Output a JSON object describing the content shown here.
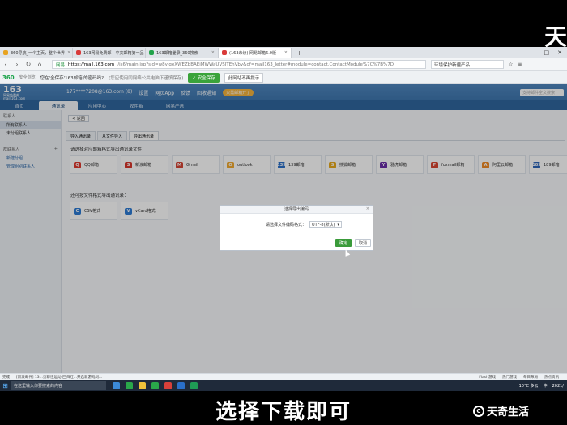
{
  "watermark": {
    "top": "天",
    "bottom": "天奇生活",
    "logo_glyph": "C"
  },
  "subtitle": "选择下载即可",
  "browser": {
    "tabs": [
      {
        "label": "360导航_一个主页，整个世界",
        "color": "#e8a320",
        "active": false
      },
      {
        "label": "163网易免费邮 - 中文邮箱第一品",
        "color": "#d93a3a",
        "active": false
      },
      {
        "label": "163邮箱登录_360搜索",
        "color": "#22a34a",
        "active": false
      },
      {
        "label": "(163未读) 网易邮箱6.0版",
        "color": "#d93a3a",
        "active": true
      }
    ],
    "tab_add": "+",
    "url": {
      "secure_label": "网易",
      "host": "https://mail.163.com",
      "path": "/js6/main.jsp?sid=w8yiqeXWEZbBAEjMWWaUVSITEhVby&df=mail163_letter#module=contact.ContactModule%7C%7B%7D"
    },
    "search_placeholder": "环境保护新疆产品",
    "addr_right": [
      "☆",
      "≡"
    ]
  },
  "secbar": {
    "logo": "360",
    "logo_sub": "安全浏览",
    "question": "您在'全保存'163邮箱'的密码吗?",
    "note": "(您应使用同网络公共电脑下谨慎保存)",
    "save_button": "✓ 安全保存",
    "dont_save_button": "此网站不再提示"
  },
  "mail": {
    "logo": "163",
    "logo_brand": "网易免费邮",
    "logo_domain": "mail.163.com",
    "account": "177****7208@163.com (8)",
    "links": [
      "设置",
      "网页App",
      "反馈",
      "回收通知"
    ],
    "promo": "只需邮箱开了",
    "search_placeholder": "支持邮件全文搜索",
    "nav": [
      "首页",
      "通讯录",
      "应用中心",
      "收件箱",
      "网易严选"
    ],
    "nav_active": 1,
    "sidebar": {
      "section1": "联系人",
      "items1": [
        "所有联系人",
        "未分组联系人"
      ],
      "section2": "群联系人",
      "section2_add": "+",
      "items2": [
        "新建分组",
        "管理组别联系人"
      ]
    },
    "back": "< 返回",
    "subtabs": [
      "导入通讯录",
      "从文件导入",
      "导出通讯录"
    ],
    "subtab_active": 2,
    "hint": "请选择对应邮箱格式导出通讯录文件：",
    "providers": [
      {
        "label": "QQ邮箱",
        "color": "#e0382c",
        "glyph": "Q"
      },
      {
        "label": "新浪邮箱",
        "color": "#d9362b",
        "glyph": "S"
      },
      {
        "label": "Gmail",
        "color": "#d64534",
        "glyph": "M"
      },
      {
        "label": "outlook",
        "color": "#f0a82f",
        "glyph": "O"
      },
      {
        "label": "139邮箱",
        "color": "#2a6fc9",
        "glyph": "139"
      },
      {
        "label": "搜狐邮箱",
        "color": "#e7a91d",
        "glyph": "S"
      },
      {
        "label": "雅虎邮箱",
        "color": "#6a2ea8",
        "glyph": "Y"
      },
      {
        "label": "foxmail邮箱",
        "color": "#d84430",
        "glyph": "F"
      },
      {
        "label": "阿里云邮箱",
        "color": "#f08a24",
        "glyph": "A"
      },
      {
        "label": "189邮箱",
        "color": "#2c64b8",
        "glyph": "189"
      }
    ],
    "hint2": "还可按文件格式导出通讯录：",
    "formats": [
      {
        "label": "CSV格式",
        "color": "#2c7bd4",
        "glyph": "C"
      },
      {
        "label": "vCard格式",
        "color": "#2c7bd4",
        "glyph": "V"
      }
    ]
  },
  "dialog": {
    "title": "选择导出编码",
    "close": "×",
    "field_label": "请选择文件编码格式：",
    "select_value": "UTF-8(默认)",
    "select_arrow": "▾",
    "ok": "确定",
    "cancel": "取消"
  },
  "statusbar": {
    "left": [
      "完成",
      "[新浪邮件] 13...页聊性运动(回归红...开启新游戏问..."
    ],
    "right": [
      "Flash游戏",
      "热门游戏",
      "每日布局",
      "热点资讯"
    ]
  },
  "taskbar": {
    "start": "⊞",
    "search": "在这里输入你要搜索的内容",
    "weather": "10°C 多云",
    "lang": "中",
    "time": "2021/"
  }
}
